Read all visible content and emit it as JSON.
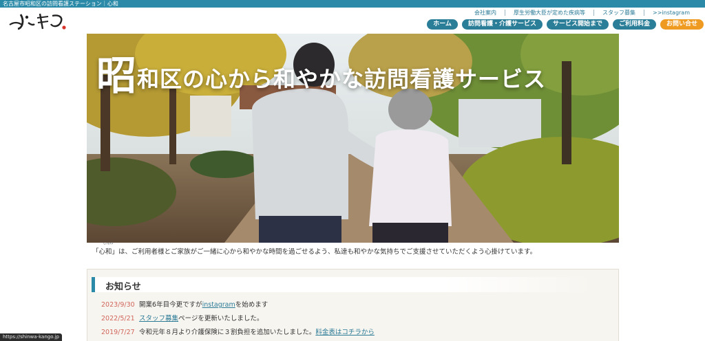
{
  "topbar": {
    "text": "名古屋市昭和区の訪問看護ステーション｜心和"
  },
  "logo": {
    "text": "心和"
  },
  "toplinks": [
    "会社案内",
    "厚生労働大臣が定めた疾病等",
    "スタッフ募集",
    ">>instagram"
  ],
  "nav": {
    "home": "ホーム",
    "services": "訪問看護・介護サービス",
    "start": "サービス開始まで",
    "fees": "ご利用料金",
    "contact": "お問い合せ"
  },
  "colors": {
    "brand": "#2a8aa7",
    "nav": "#2a7e98",
    "contact": "#ef9a21",
    "date": "#d1655b"
  },
  "hero": {
    "title_big": "昭",
    "title_rest": "和区の心から和やかな訪問看護サービス"
  },
  "intro": {
    "open_quote": "「",
    "ruby_base": "心和",
    "ruby_text": "しんわ",
    "body": "」は、ご利用者様とご家族がご一緒に心から和やかな時間を過ごせるよう、私達も和やかな気持ちでご支援させていただくよう心掛けています。"
  },
  "news": {
    "title": "お知らせ",
    "items": [
      {
        "date": "2023/9/30",
        "pre": "開業6年目今更ですが",
        "link": "instagram",
        "post": "を始めます"
      },
      {
        "date": "2022/5/21",
        "pre": "",
        "link": "スタッフ募集",
        "post": "ページを更新いたしました。"
      },
      {
        "date": "2019/7/27",
        "pre": "令和元年８月より介護保険に３割負担を追加いたしました。",
        "link": "料金表はコチラから",
        "post": ""
      }
    ]
  },
  "status": {
    "url": "https://shinwa-kango.jp"
  }
}
